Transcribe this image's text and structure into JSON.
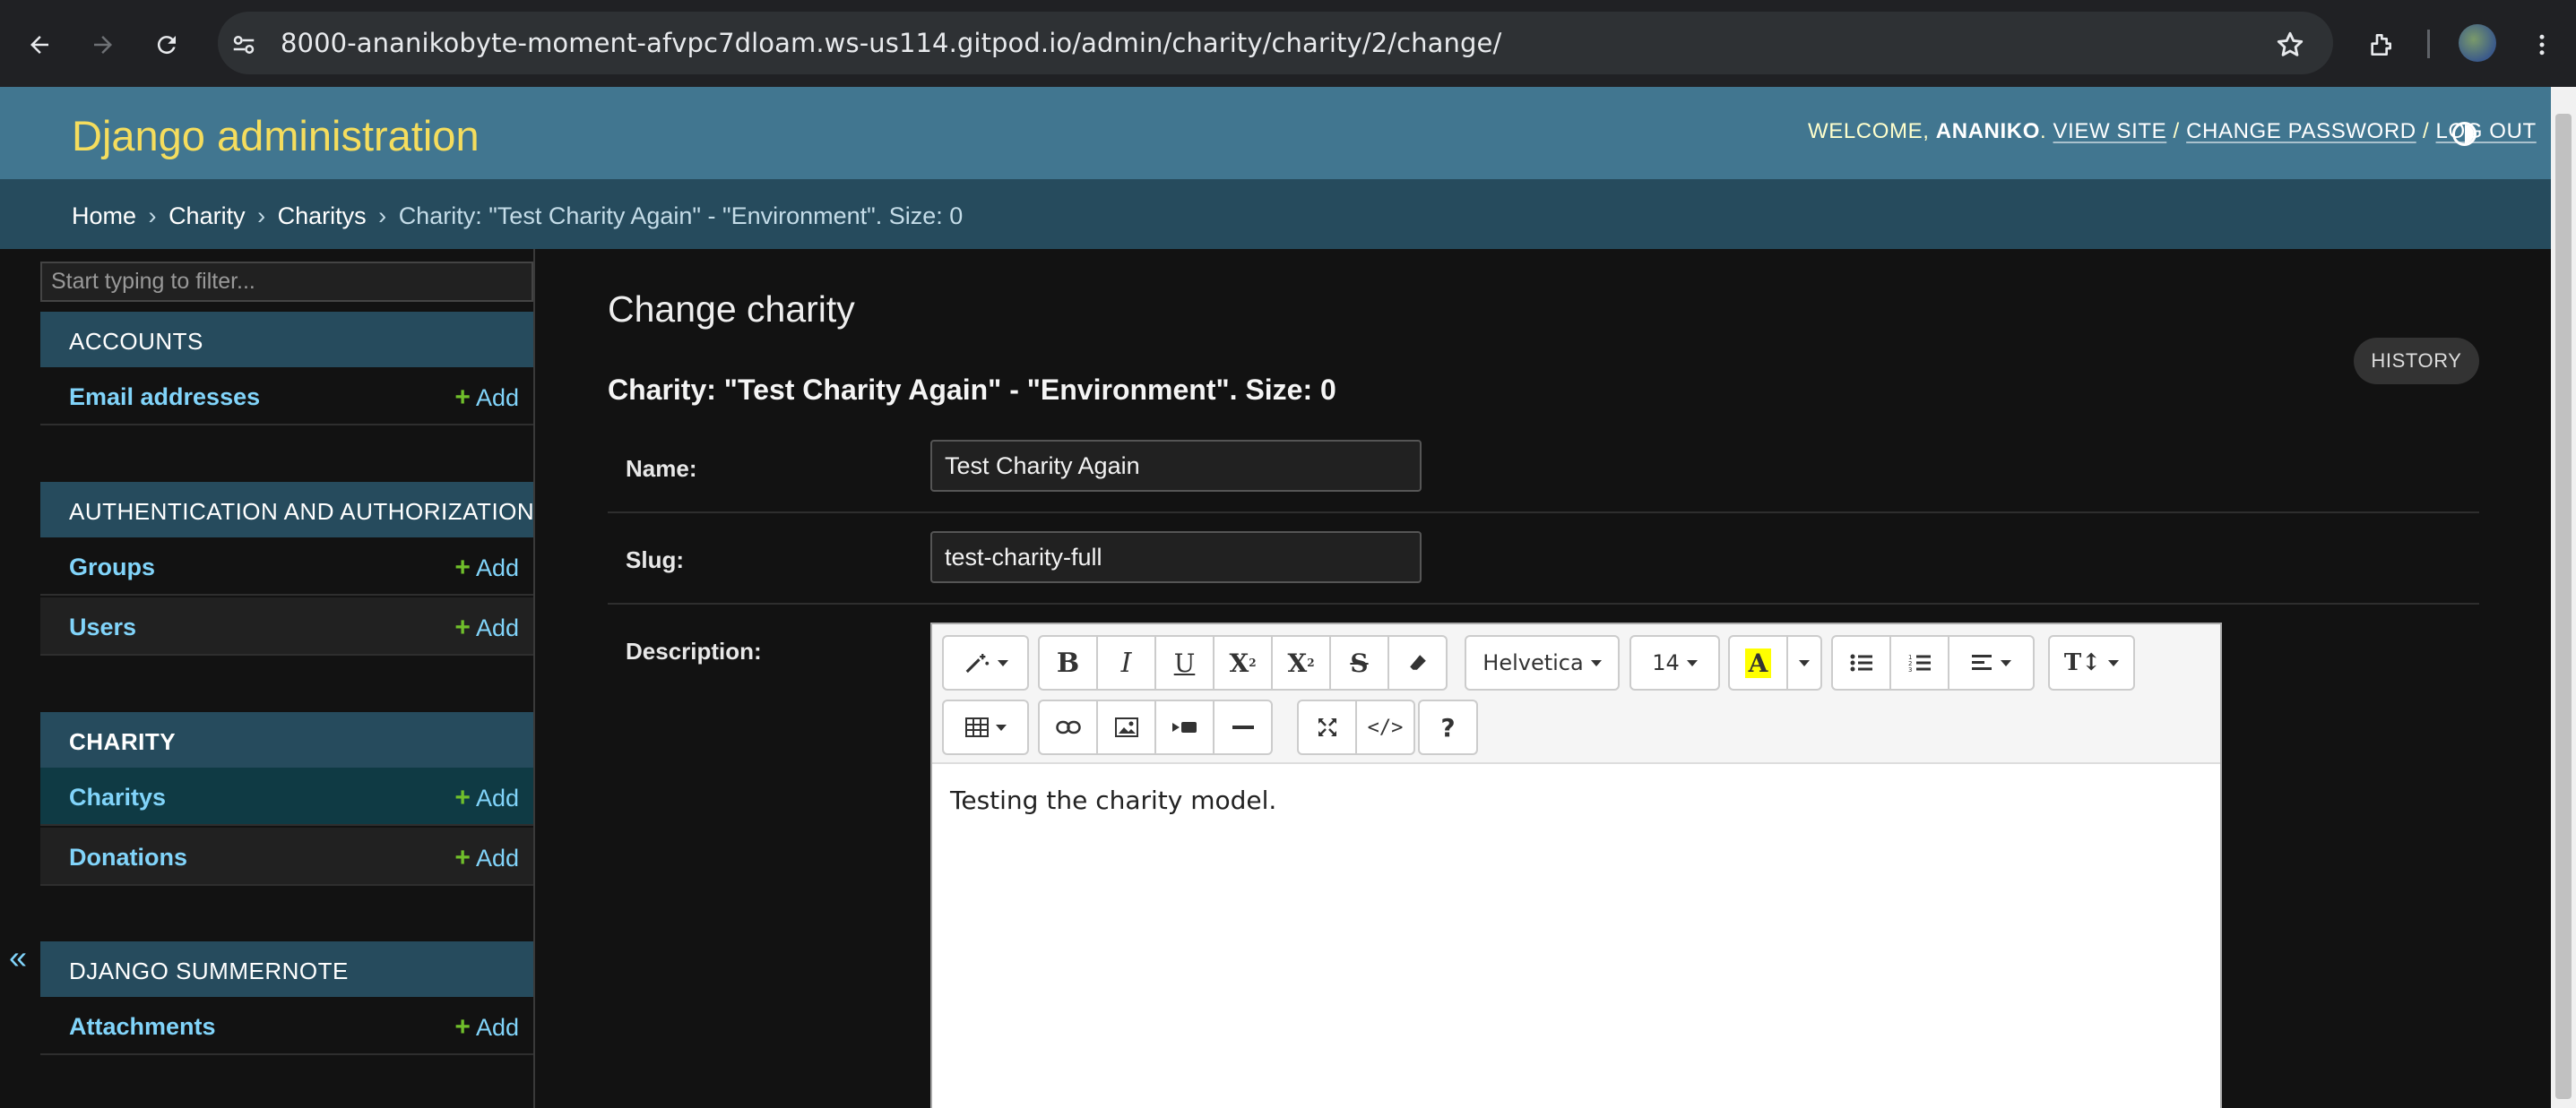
{
  "browser": {
    "url": "8000-ananikobyte-moment-afvpc7dloam.ws-us114.gitpod.io/admin/charity/charity/2/change/"
  },
  "header": {
    "site_title": "Django administration",
    "welcome": "WELCOME,",
    "username": "ANANIKO",
    "view_site": "VIEW SITE",
    "change_password": "CHANGE PASSWORD",
    "log_out": "LOG OUT",
    "sep": "/"
  },
  "breadcrumbs": {
    "home": "Home",
    "app": "Charity",
    "model": "Charitys",
    "current": "Charity: \"Test Charity Again\" - \"Environment\". Size: 0",
    "sep": "›"
  },
  "sidebar": {
    "filter_placeholder": "Start typing to filter...",
    "add_label": "Add",
    "apps": [
      {
        "caption": "ACCOUNTS",
        "models": [
          {
            "name": "Email addresses"
          }
        ]
      },
      {
        "caption": "AUTHENTICATION AND AUTHORIZATION",
        "models": [
          {
            "name": "Groups"
          },
          {
            "name": "Users"
          }
        ]
      },
      {
        "caption": "CHARITY",
        "models": [
          {
            "name": "Charitys"
          },
          {
            "name": "Donations"
          }
        ]
      },
      {
        "caption": "DJANGO SUMMERNOTE",
        "models": [
          {
            "name": "Attachments"
          }
        ]
      }
    ],
    "collapse_glyph": "«"
  },
  "content": {
    "title": "Change charity",
    "history": "HISTORY",
    "object_title": "Charity: \"Test Charity Again\" - \"Environment\". Size: 0",
    "fields": {
      "name_label": "Name:",
      "name_value": "Test Charity Again",
      "slug_label": "Slug:",
      "slug_value": "test-charity-full",
      "description_label": "Description:"
    }
  },
  "editor": {
    "font_family": "Helvetica",
    "font_size": "14",
    "body": "Testing the charity model.",
    "toolbar_icons": [
      "magic-style-icon",
      "bold-icon",
      "italic-icon",
      "underline-icon",
      "superscript-icon",
      "subscript-icon",
      "strikethrough-icon",
      "eraser-icon",
      "font-name-dropdown",
      "font-size-dropdown",
      "text-color-icon",
      "color-dropdown-icon",
      "unordered-list-icon",
      "ordered-list-icon",
      "paragraph-align-icon",
      "line-height-icon",
      "table-icon",
      "link-icon",
      "picture-icon",
      "video-icon",
      "horizontal-rule-icon",
      "fullscreen-icon",
      "codeview-icon",
      "help-icon"
    ],
    "highlight_color": "#ffff00"
  },
  "colors": {
    "header_bg": "#417690",
    "breadcrumb_bg": "#264b5d",
    "title_yellow": "#f5dd5d",
    "link_blue": "#81d4fa",
    "add_green": "#70bf2b"
  }
}
